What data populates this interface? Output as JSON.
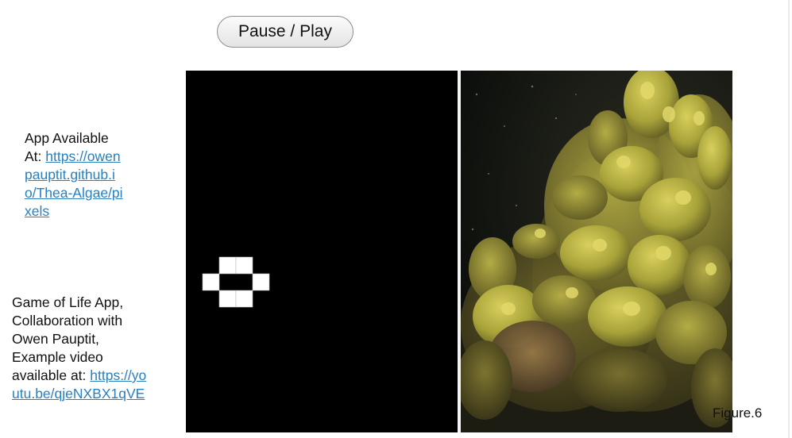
{
  "controls": {
    "pause_play_label": "Pause / Play"
  },
  "app_note": {
    "text": "App Available At: ",
    "link_text": "https://owenpauptit.github.io/Thea-Algae/pixels"
  },
  "game_note": {
    "text": "Game of Life App, Collaboration with Owen Pauptit, Example video available at: ",
    "link_text": "https://youtu.be/qjeNXBX1qVE"
  },
  "life_grid": {
    "background_color": "#000000",
    "cell_color": "#ffffff",
    "shape": "beehive"
  },
  "photo": {
    "subject": "underwater seaweed (algae) photograph"
  },
  "figure_caption": "Figure.6"
}
